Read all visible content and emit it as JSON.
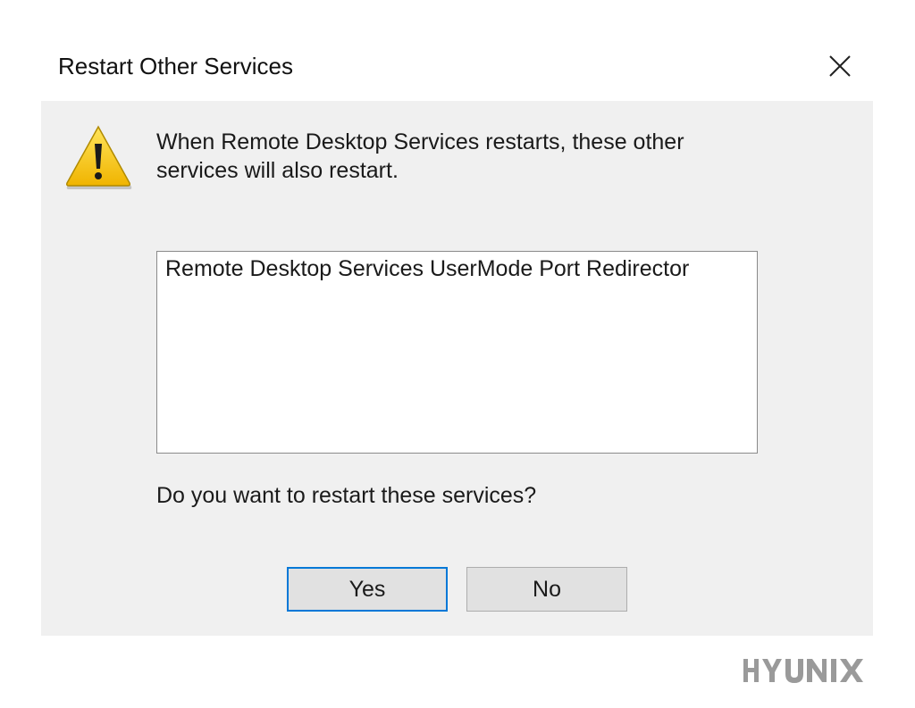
{
  "dialog": {
    "title": "Restart Other Services",
    "message": "When Remote Desktop Services restarts, these other services will also restart.",
    "services": [
      "Remote Desktop Services UserMode Port Redirector"
    ],
    "question": "Do you want to restart these services?",
    "buttons": {
      "yes_label": "Yes",
      "no_label": "No"
    },
    "icons": {
      "warning": "warning-icon",
      "close": "close-icon"
    }
  },
  "watermark": {
    "text": "HYUNIX"
  },
  "colors": {
    "dialog_background": "#f0f0f0",
    "title_background": "#ffffff",
    "focus_border": "#0078d7",
    "warning_yellow": "#f6c400",
    "watermark_gray": "#9a9a9a"
  }
}
